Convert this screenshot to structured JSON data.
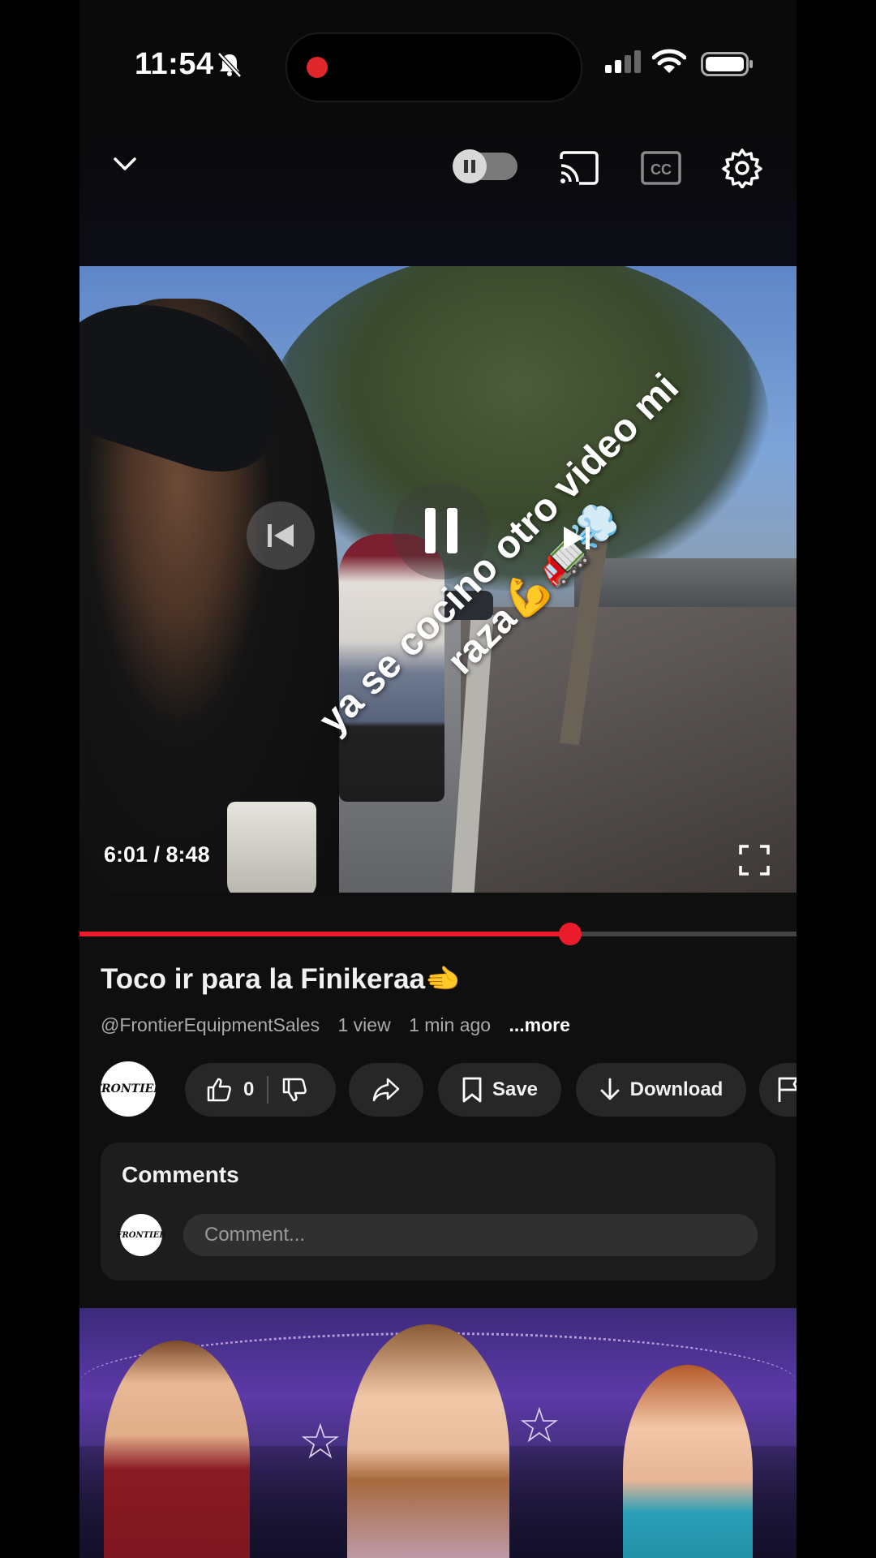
{
  "status_bar": {
    "time": "11:54",
    "silent_icon": "bell-slash-icon",
    "recording_color": "#e0272b"
  },
  "player": {
    "toolbar": {
      "collapse_icon": "chevron-down-icon",
      "autoplay_icon": "autoplay-toggle-icon",
      "cast_icon": "cast-icon",
      "captions_icon": "closed-captions-icon",
      "settings_icon": "gear-icon"
    },
    "overlay_caption": "ya se cocino otro video mi raza💪🚛💨",
    "time_display": "6:01 / 8:48",
    "progress_fraction": 0.684,
    "progress_color": "#ea1c2c"
  },
  "video": {
    "title": "Toco ir para la Finikeraa🫲",
    "channel": "@FrontierEquipmentSales",
    "views": "1 view",
    "age": "1 min ago",
    "more": "...more",
    "avatar_text": "FRONTIER",
    "actions": {
      "like_count": "0",
      "save_label": "Save",
      "download_label": "Download"
    }
  },
  "comments": {
    "title": "Comments",
    "placeholder": "Comment..."
  }
}
